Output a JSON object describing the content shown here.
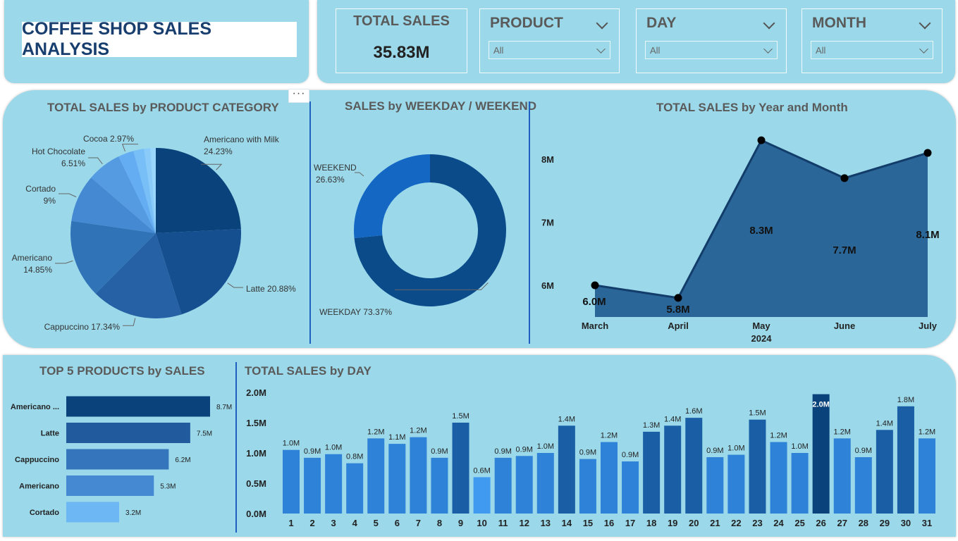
{
  "header": {
    "title": "COFFEE SHOP SALES ANALYSIS"
  },
  "kpi": {
    "label": "TOTAL SALES",
    "value": "35.83M"
  },
  "filters": [
    {
      "label": "PRODUCT",
      "selected": "All"
    },
    {
      "label": "DAY",
      "selected": "All"
    },
    {
      "label": "MONTH",
      "selected": "All"
    }
  ],
  "more_options": "···",
  "chart_data": [
    {
      "type": "pie",
      "title": "TOTAL SALES by PRODUCT CATEGORY",
      "slices": [
        {
          "label": "Americano with Milk",
          "pct": "24.23%",
          "value": 24.23,
          "color": "#0a427b"
        },
        {
          "label": "Latte",
          "pct": "20.88%",
          "value": 20.88,
          "color": "#164f8f"
        },
        {
          "label": "Cappuccino",
          "pct": "17.34%",
          "value": 17.34,
          "color": "#2561a4"
        },
        {
          "label": "Americano",
          "pct": "14.85%",
          "value": 14.85,
          "color": "#3173b7"
        },
        {
          "label": "Cortado",
          "pct": "9%",
          "value": 9.0,
          "color": "#4489d1"
        },
        {
          "label": "Hot Chocolate",
          "pct": "6.51%",
          "value": 6.51,
          "color": "#549be2"
        },
        {
          "label": "Cocoa",
          "pct": "2.97%",
          "value": 2.97,
          "color": "#65adf2"
        },
        {
          "label": "",
          "pct": "",
          "value": 2.0,
          "color": "#78bff8"
        },
        {
          "label": "",
          "pct": "",
          "value": 1.2,
          "color": "#8acbfa"
        },
        {
          "label": "",
          "pct": "",
          "value": 1.02,
          "color": "#9ad6fc"
        }
      ]
    },
    {
      "type": "pie",
      "title": "SALES by WEEKDAY / WEEKEND",
      "slices": [
        {
          "label": "WEEKDAY",
          "pct": "73.37%",
          "value": 73.37,
          "color": "#0b4b8a"
        },
        {
          "label": "WEEKEND",
          "pct": "26.63%",
          "value": 26.63,
          "color": "#1468c4"
        }
      ]
    },
    {
      "type": "area",
      "title": "TOTAL SALES by Year and Month",
      "categories": [
        "March",
        "April",
        "May",
        "June",
        "July"
      ],
      "year_label": "2024",
      "values": [
        6.0,
        5.8,
        8.3,
        7.7,
        8.1
      ],
      "labels": [
        "6.0M",
        "5.8M",
        "8.3M",
        "7.7M",
        "8.1M"
      ],
      "yticks": [
        {
          "v": 6,
          "label": "6M"
        },
        {
          "v": 7,
          "label": "7M"
        },
        {
          "v": 8,
          "label": "8M"
        }
      ],
      "ylim": [
        5.5,
        8.5
      ],
      "color": "#2b6698"
    },
    {
      "type": "bar",
      "orientation": "horizontal",
      "title": "TOP 5 PRODUCTS by SALES",
      "categories": [
        "Americano ...",
        "Latte",
        "Cappuccino",
        "Americano",
        "Cortado"
      ],
      "values": [
        8.7,
        7.5,
        6.2,
        5.3,
        3.2
      ],
      "labels": [
        "8.7M",
        "7.5M",
        "6.2M",
        "5.3M",
        "3.2M"
      ],
      "colors": [
        "#0a427b",
        "#215b9d",
        "#3575bc",
        "#4589d2",
        "#6db7f5"
      ]
    },
    {
      "type": "bar",
      "title": "TOTAL SALES by DAY",
      "categories": [
        "1",
        "2",
        "3",
        "4",
        "5",
        "6",
        "7",
        "8",
        "9",
        "10",
        "11",
        "12",
        "13",
        "14",
        "15",
        "16",
        "17",
        "18",
        "19",
        "20",
        "21",
        "22",
        "23",
        "24",
        "25",
        "26",
        "27",
        "28",
        "29",
        "30",
        "31"
      ],
      "values": [
        1.05,
        0.92,
        0.98,
        0.83,
        1.24,
        1.15,
        1.26,
        0.92,
        1.5,
        0.6,
        0.92,
        0.95,
        1.0,
        1.45,
        0.9,
        1.18,
        0.86,
        1.35,
        1.45,
        1.58,
        0.93,
        0.97,
        1.55,
        1.18,
        1.0,
        1.97,
        1.24,
        0.93,
        1.38,
        1.77,
        1.24
      ],
      "labels": [
        "1.0M",
        "0.9M",
        "1.0M",
        "0.8M",
        "1.2M",
        "1.1M",
        "1.2M",
        "0.9M",
        "1.5M",
        "0.6M",
        "0.9M",
        "0.9M",
        "1.0M",
        "1.4M",
        "0.9M",
        "1.2M",
        "0.9M",
        "1.3M",
        "1.4M",
        "1.6M",
        "0.9M",
        "1.0M",
        "1.5M",
        "1.2M",
        "1.0M",
        "2.0M",
        "1.2M",
        "0.9M",
        "1.4M",
        "1.8M",
        "1.2M"
      ],
      "ylim": [
        0,
        2.0
      ],
      "yticks": [
        {
          "v": 0,
          "label": "0.0M"
        },
        {
          "v": 0.5,
          "label": "0.5M"
        },
        {
          "v": 1.0,
          "label": "1.0M"
        },
        {
          "v": 1.5,
          "label": "1.5M"
        },
        {
          "v": 2.0,
          "label": "2.0M"
        }
      ],
      "colors": {
        "low": "#3f9af0",
        "mid": "#2e82d8",
        "high": "#1a5fa6",
        "top": "#0a427b"
      }
    }
  ]
}
